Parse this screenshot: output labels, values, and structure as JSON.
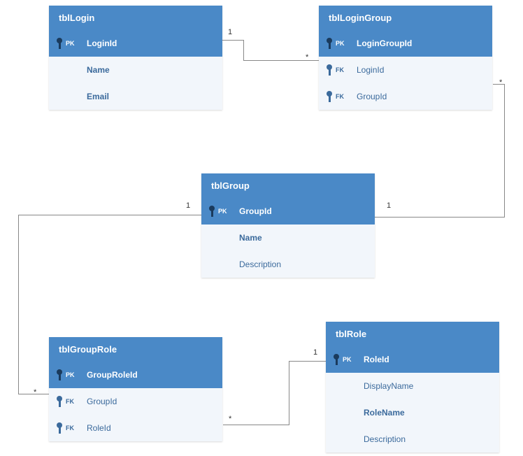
{
  "diagram": {
    "entities": {
      "tblLogin": {
        "title": "tblLogin",
        "rows": [
          {
            "keyType": "PK",
            "name": "LoginId",
            "bold": true
          },
          {
            "keyType": null,
            "name": "Name",
            "bold": true
          },
          {
            "keyType": null,
            "name": "Email",
            "bold": true
          }
        ]
      },
      "tblLoginGroup": {
        "title": "tblLoginGroup",
        "rows": [
          {
            "keyType": "PK",
            "name": "LoginGroupId",
            "bold": true
          },
          {
            "keyType": "FK",
            "name": "LoginId",
            "bold": false
          },
          {
            "keyType": "FK",
            "name": "GroupId",
            "bold": false
          }
        ]
      },
      "tblGroup": {
        "title": "tblGroup",
        "rows": [
          {
            "keyType": "PK",
            "name": "GroupId",
            "bold": true
          },
          {
            "keyType": null,
            "name": "Name",
            "bold": true
          },
          {
            "keyType": null,
            "name": "Description",
            "bold": false
          }
        ]
      },
      "tblGroupRole": {
        "title": "tblGroupRole",
        "rows": [
          {
            "keyType": "PK",
            "name": "GroupRoleId",
            "bold": true
          },
          {
            "keyType": "FK",
            "name": "GroupId",
            "bold": false
          },
          {
            "keyType": "FK",
            "name": "RoleId",
            "bold": false
          }
        ]
      },
      "tblRole": {
        "title": "tblRole",
        "rows": [
          {
            "keyType": "PK",
            "name": "RoleId",
            "bold": true
          },
          {
            "keyType": null,
            "name": "DisplayName",
            "bold": false
          },
          {
            "keyType": null,
            "name": "RoleName",
            "bold": true
          },
          {
            "keyType": null,
            "name": "Description",
            "bold": false
          }
        ]
      }
    },
    "cardinality": {
      "one": "1",
      "many": "*"
    }
  }
}
